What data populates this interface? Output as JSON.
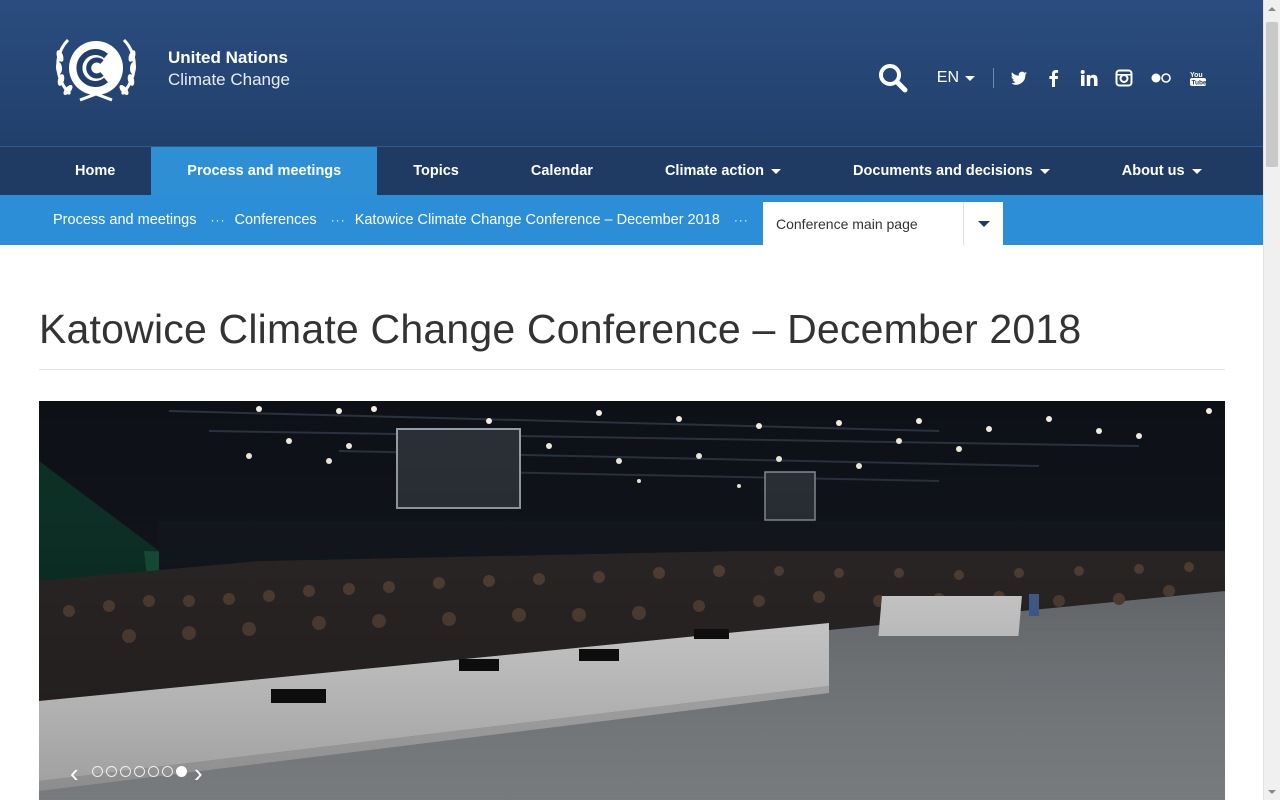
{
  "header": {
    "org_line1": "United Nations",
    "org_line2": "Climate Change",
    "logo_icon": "unfccc-logo",
    "search_icon": "search-icon",
    "language": "EN",
    "social_icons": [
      "twitter-icon",
      "facebook-icon",
      "linkedin-icon",
      "instagram-icon",
      "flickr-icon",
      "youtube-icon"
    ]
  },
  "nav": {
    "items": [
      {
        "label": "Home",
        "active": false,
        "dropdown": false
      },
      {
        "label": "Process and meetings",
        "active": true,
        "dropdown": false
      },
      {
        "label": "Topics",
        "active": false,
        "dropdown": false
      },
      {
        "label": "Calendar",
        "active": false,
        "dropdown": false
      },
      {
        "label": "Climate action",
        "active": false,
        "dropdown": true
      },
      {
        "label": "Documents and decisions",
        "active": false,
        "dropdown": true
      },
      {
        "label": "About us",
        "active": false,
        "dropdown": true
      }
    ]
  },
  "breadcrumb": {
    "items": [
      "Process and meetings",
      "Conferences",
      "Katowice Climate Change Conference – December 2018"
    ],
    "separator": "···",
    "select_value": "Conference main page"
  },
  "main": {
    "title": "Katowice Climate Change Conference – December 2018"
  },
  "carousel": {
    "prev": "‹",
    "next": "›",
    "slide_count": 7,
    "active_slide": 7
  },
  "colors": {
    "header_bg": "#213f6b",
    "nav_bg": "#1f3b63",
    "accent": "#2b8ed6",
    "title_text": "#333333"
  }
}
